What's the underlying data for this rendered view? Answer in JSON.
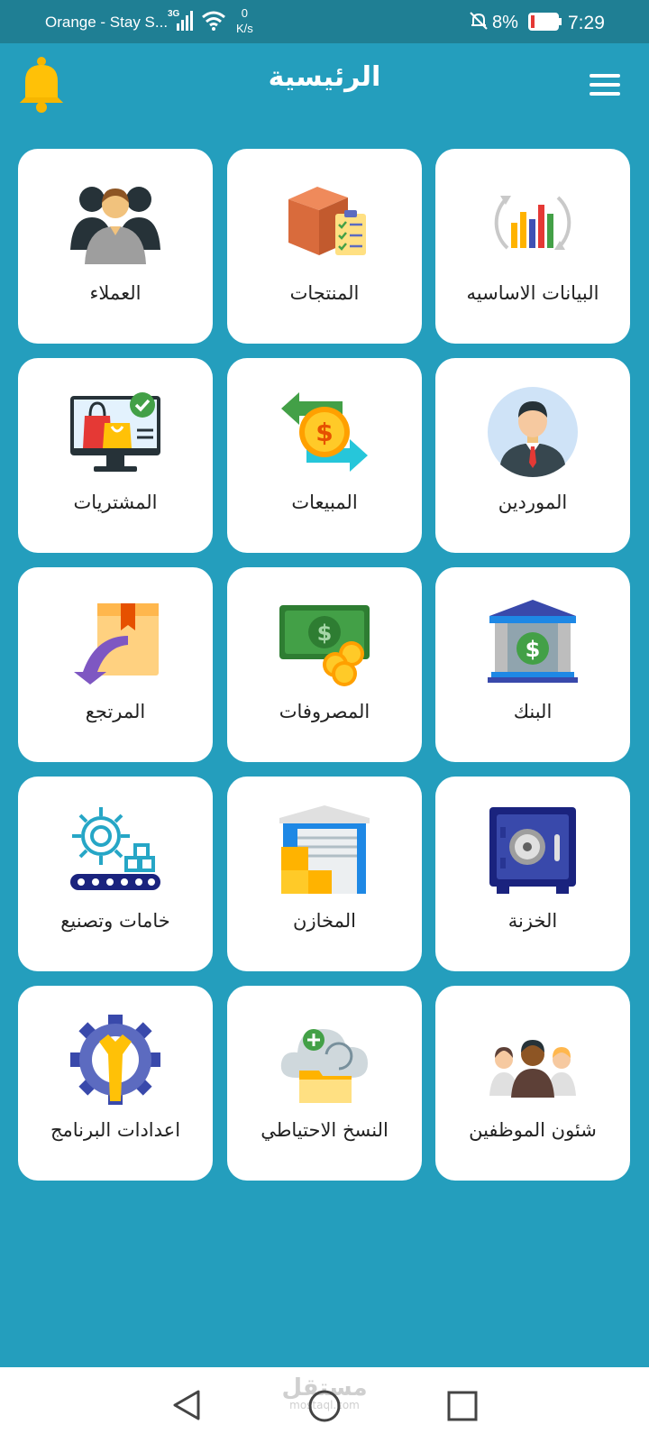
{
  "status_bar": {
    "carrier": "Orange - Stay S...",
    "network_type": "3G",
    "speed_value": "0",
    "speed_unit": "K/s",
    "battery_percent": "8%",
    "time": "7:29"
  },
  "header": {
    "title": "الرئيسية",
    "notification_icon": "bell-icon",
    "menu_icon": "hamburger-menu-icon"
  },
  "tiles": [
    {
      "label": "البيانات الاساسيه",
      "icon": "chart-icon"
    },
    {
      "label": "المنتجات",
      "icon": "box-checklist-icon"
    },
    {
      "label": "العملاء",
      "icon": "customers-icon"
    },
    {
      "label": "الموردين",
      "icon": "supplier-avatar-icon"
    },
    {
      "label": "المبيعات",
      "icon": "dollar-exchange-icon"
    },
    {
      "label": "المشتريات",
      "icon": "shopping-monitor-icon"
    },
    {
      "label": "البنك",
      "icon": "bank-icon"
    },
    {
      "label": "المصروفات",
      "icon": "cash-coins-icon"
    },
    {
      "label": "المرتجع",
      "icon": "return-box-icon"
    },
    {
      "label": "الخزنة",
      "icon": "safe-icon"
    },
    {
      "label": "المخازن",
      "icon": "warehouse-icon"
    },
    {
      "label": "خامات وتصنيع",
      "icon": "manufacturing-gear-icon"
    },
    {
      "label": "شئون الموظفين",
      "icon": "employees-icon"
    },
    {
      "label": "النسخ الاحتياطي",
      "icon": "cloud-backup-icon"
    },
    {
      "label": "اعدادات البرنامج",
      "icon": "settings-wrench-icon"
    }
  ],
  "watermark": {
    "text": "مستقل",
    "sub": "mostaql.com"
  },
  "nav_bar": {
    "back_icon": "back-triangle-icon",
    "home_icon": "home-circle-icon",
    "recent_icon": "recent-square-icon"
  }
}
